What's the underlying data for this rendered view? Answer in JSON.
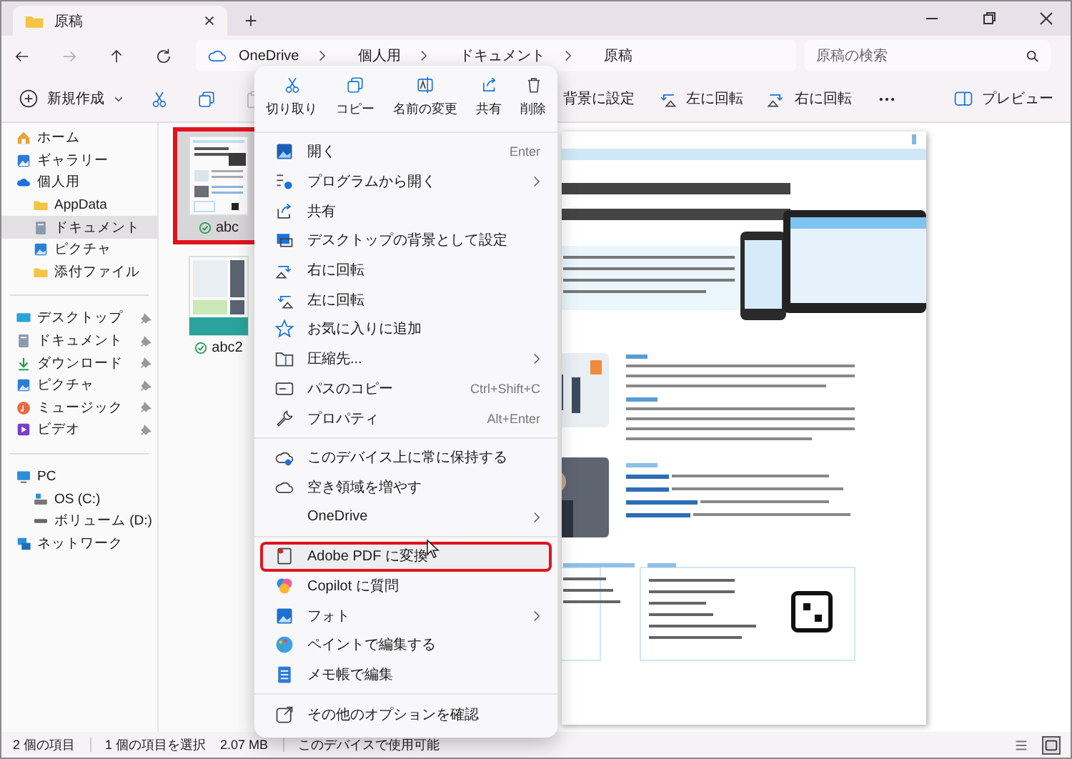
{
  "window": {
    "tab_title": "原稿"
  },
  "address": {
    "breadcrumbs": [
      "OneDrive",
      "個人用",
      "ドキュメント",
      "原稿"
    ]
  },
  "search": {
    "placeholder": "原稿の検索"
  },
  "toolbar": {
    "new_button": "新規作成",
    "actions": [
      "背景に設定",
      "左に回転",
      "右に回転"
    ],
    "preview_button": "プレビュー"
  },
  "sidebar": {
    "groups": [
      {
        "items": [
          {
            "label": "ホーム",
            "selected": false
          },
          {
            "label": "ギャラリー",
            "selected": false
          },
          {
            "label": "個人用",
            "selected": false,
            "children": [
              {
                "label": "AppData",
                "selected": false
              },
              {
                "label": "ドキュメント",
                "selected": true
              },
              {
                "label": "ピクチャ",
                "selected": false
              },
              {
                "label": "添付ファイル",
                "selected": false
              }
            ]
          }
        ]
      },
      {
        "items": [
          {
            "label": "デスクトップ",
            "selected": false,
            "pinned": true
          },
          {
            "label": "ドキュメント",
            "selected": false,
            "pinned": true
          },
          {
            "label": "ダウンロード",
            "selected": false,
            "pinned": true
          },
          {
            "label": "ピクチャ",
            "selected": false,
            "pinned": true
          },
          {
            "label": "ミュージック",
            "selected": false,
            "pinned": true
          },
          {
            "label": "ビデオ",
            "selected": false,
            "pinned": true
          }
        ]
      },
      {
        "items": [
          {
            "label": "PC",
            "selected": false,
            "children": [
              {
                "label": "OS (C:)",
                "selected": false
              },
              {
                "label": "ボリューム (D:)",
                "selected": false
              }
            ]
          },
          {
            "label": "ネットワーク",
            "selected": false
          }
        ]
      }
    ]
  },
  "files": [
    {
      "name": "abc",
      "selected": true,
      "highlighted": true
    },
    {
      "name": "abc2",
      "selected": false,
      "highlighted": false
    }
  ],
  "context_menu": {
    "quick_actions": [
      "切り取り",
      "コピー",
      "名前の変更",
      "共有",
      "削除"
    ],
    "groups": [
      {
        "items": [
          {
            "label": "開く",
            "shortcut": "Enter",
            "submenu": false,
            "highlighted": false
          },
          {
            "label": "プログラムから開く",
            "submenu": true,
            "highlighted": false
          },
          {
            "label": "共有",
            "submenu": false,
            "highlighted": false
          },
          {
            "label": "デスクトップの背景として設定",
            "submenu": false,
            "highlighted": false
          },
          {
            "label": "右に回転",
            "submenu": false,
            "highlighted": false
          },
          {
            "label": "左に回転",
            "submenu": false,
            "highlighted": false
          },
          {
            "label": "お気に入りに追加",
            "submenu": false,
            "highlighted": false
          },
          {
            "label": "圧縮先...",
            "submenu": true,
            "highlighted": false
          },
          {
            "label": "パスのコピー",
            "shortcut": "Ctrl+Shift+C",
            "submenu": false,
            "highlighted": false
          },
          {
            "label": "プロパティ",
            "shortcut": "Alt+Enter",
            "submenu": false,
            "highlighted": false
          }
        ]
      },
      {
        "items": [
          {
            "label": "このデバイス上に常に保持する",
            "submenu": false,
            "highlighted": false
          },
          {
            "label": "空き領域を増やす",
            "submenu": false,
            "highlighted": false
          },
          {
            "label": "OneDrive",
            "submenu": true,
            "highlighted": false
          }
        ]
      },
      {
        "items": [
          {
            "label": "Adobe PDF に変換",
            "submenu": false,
            "highlighted": true
          },
          {
            "label": "Copilot に質問",
            "submenu": false,
            "highlighted": false
          },
          {
            "label": "フォト",
            "submenu": true,
            "highlighted": false
          },
          {
            "label": "ペイントで編集する",
            "submenu": false,
            "highlighted": false
          },
          {
            "label": "メモ帳で編集",
            "submenu": false,
            "highlighted": false
          }
        ]
      },
      {
        "items": [
          {
            "label": "その他のオプションを確認",
            "submenu": false,
            "highlighted": false
          }
        ]
      }
    ]
  },
  "status_bar": {
    "item_count": "2 個の項目",
    "selection": "1 個の項目を選択",
    "size": "2.07 MB",
    "availability": "このデバイスで使用可能"
  }
}
